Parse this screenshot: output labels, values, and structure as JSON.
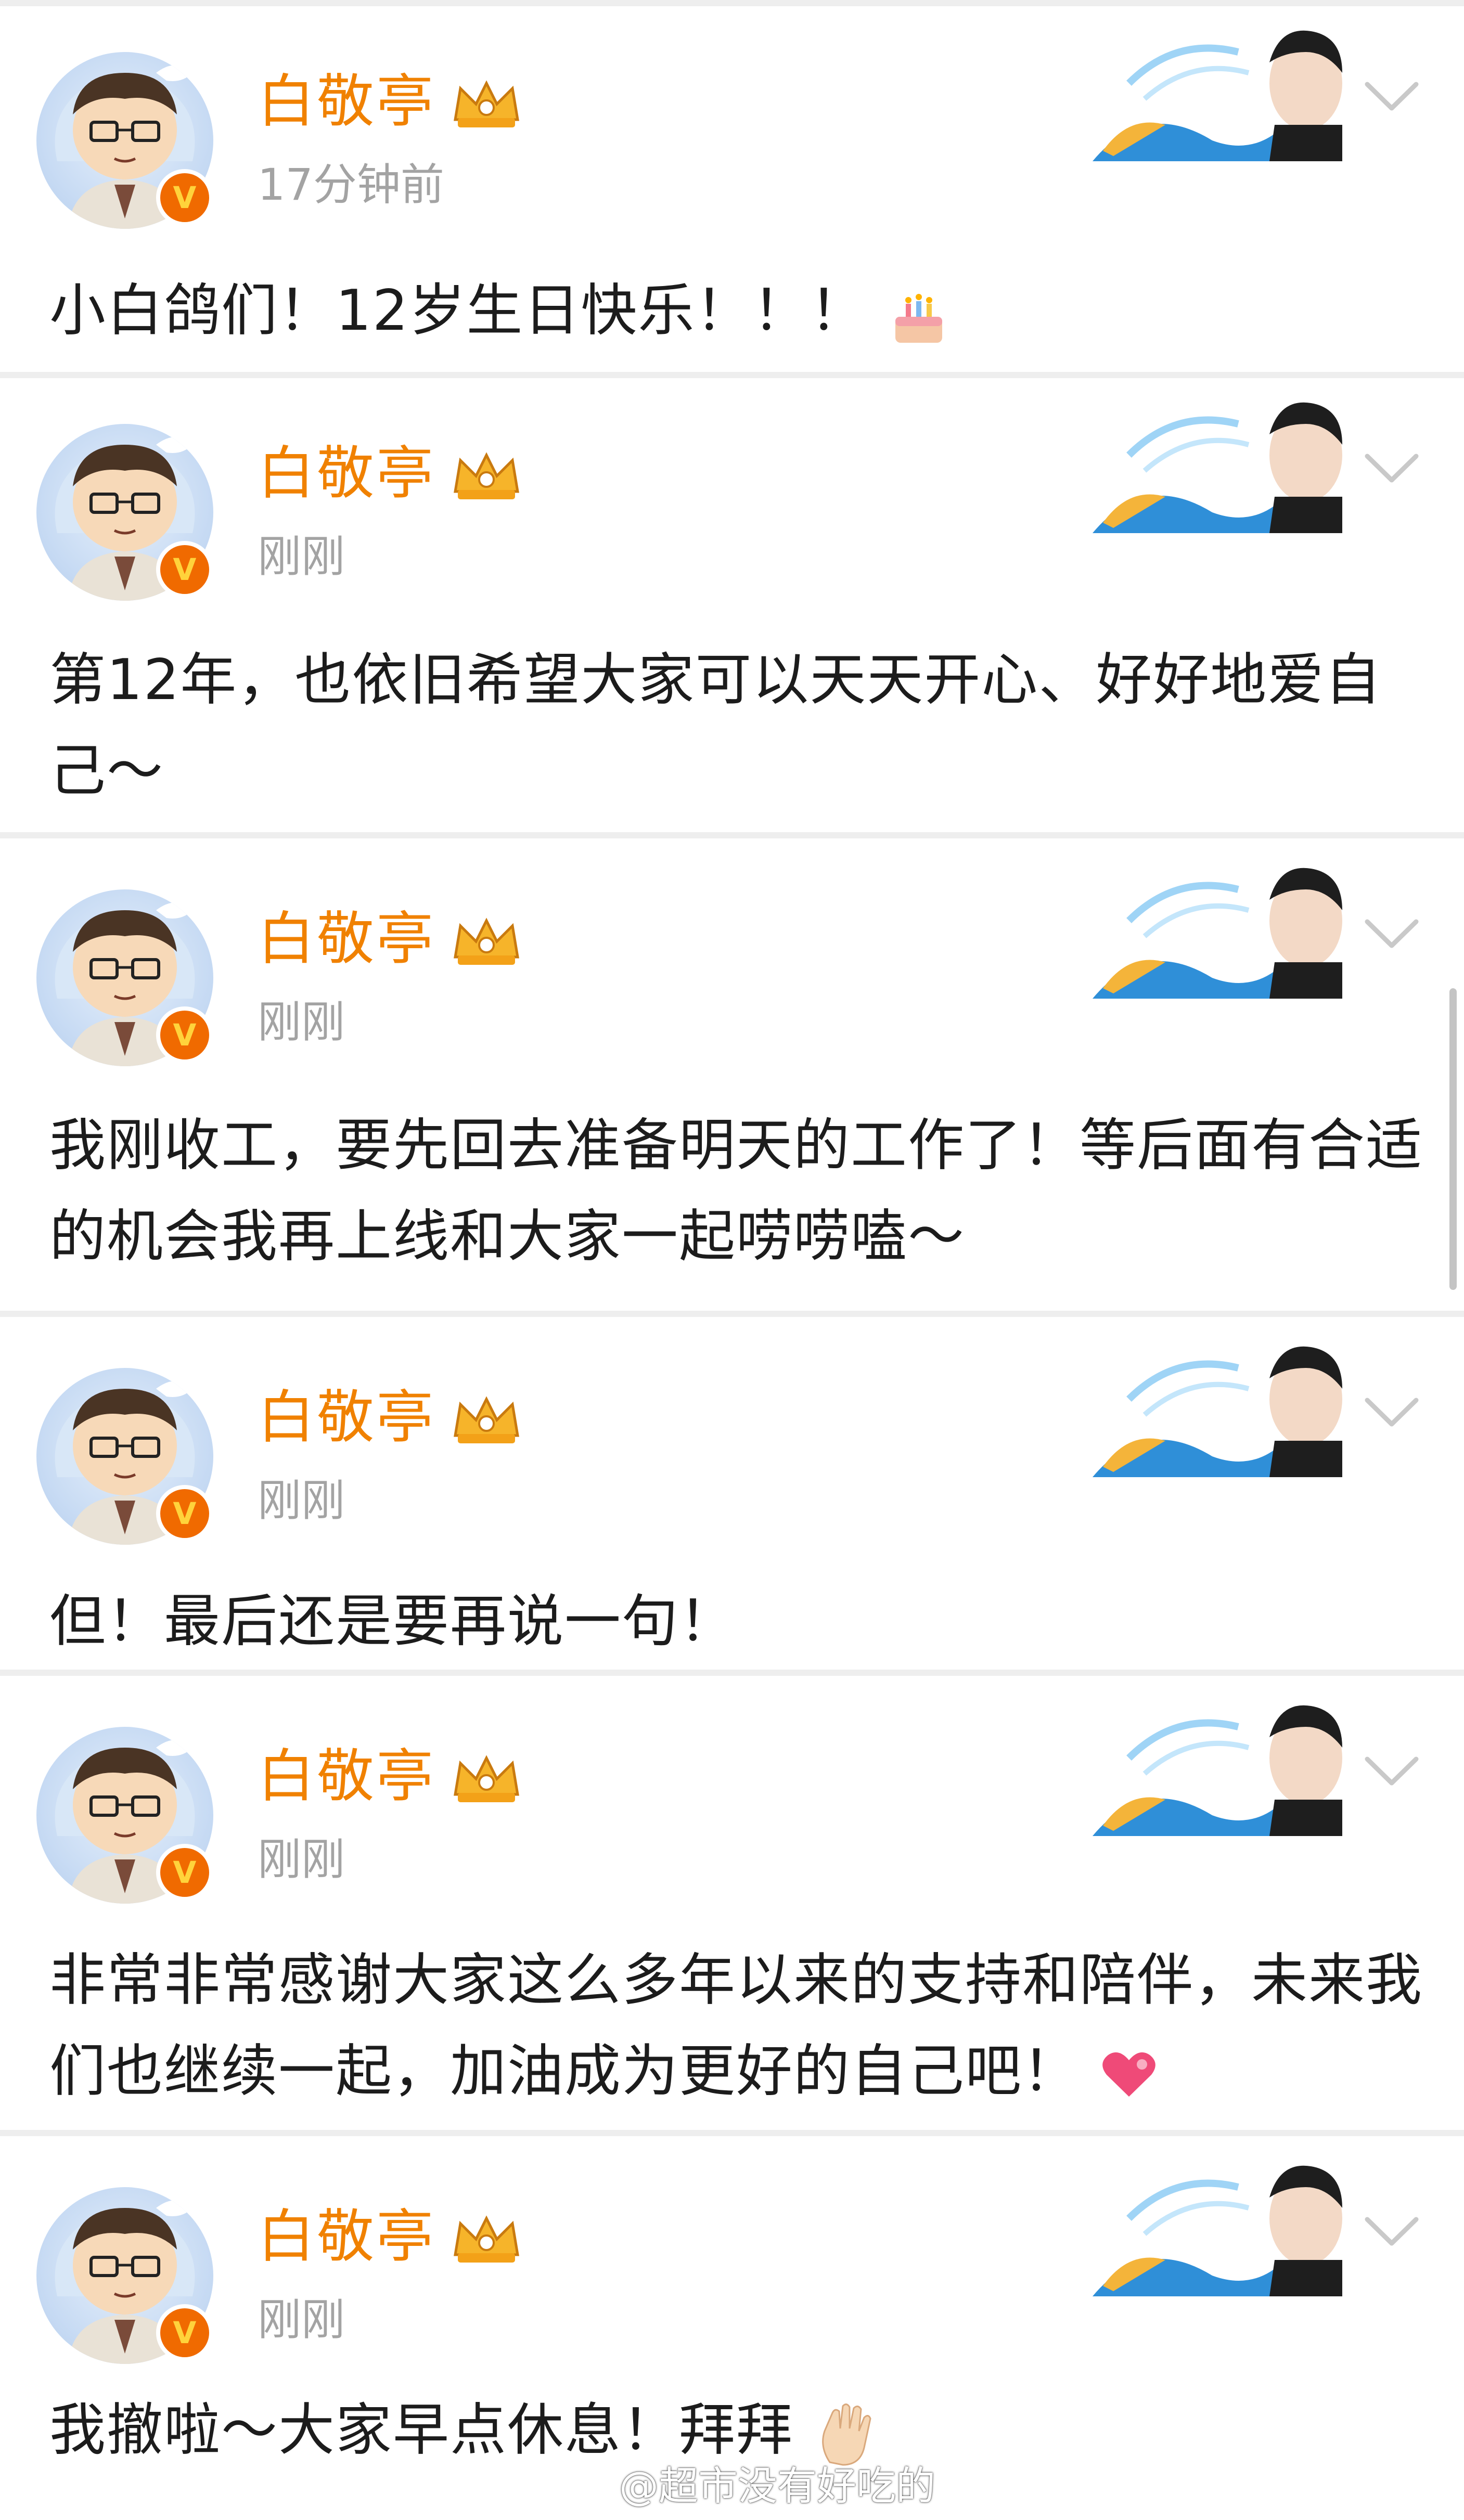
{
  "feed": {
    "username": "白敬亭",
    "icons": {
      "avatar": "cartoon-avatar-image",
      "verified": "verified-v-icon",
      "membership": "crown-membership-icon",
      "decoration": "card-decoration-image",
      "more": "chevron-down-icon"
    },
    "verified_label": "V",
    "posts": [
      {
        "time": "17分钟前",
        "text": "小白鸽们！12岁生日快乐！！！",
        "emoji": "birthday-cake-emoji"
      },
      {
        "time": "刚刚",
        "text": "第12年，也依旧希望大家可以天天开心、好好地爱自己～"
      },
      {
        "time": "刚刚",
        "text": "我刚收工，要先回去准备明天的工作了！等后面有合适的机会我再上线和大家一起唠唠嗑～"
      },
      {
        "time": "刚刚",
        "text": "但！最后还是要再说一句！"
      },
      {
        "time": "刚刚",
        "text": "非常非常感谢大家这么多年以来的支持和陪伴，未来我们也继续一起，加油成为更好的自己吧！",
        "emoji": "heart-emoji"
      },
      {
        "time": "刚刚",
        "text": "我撤啦～大家早点休息！拜拜",
        "emoji": "waving-hand-emoji"
      }
    ]
  },
  "watermark": {
    "text": "@超市没有好吃的",
    "icon": "weibo-logo-icon"
  },
  "colors": {
    "username": "#f08100",
    "timestamp": "#a3a3a3",
    "text": "#1c1c1c",
    "badge": "#f06a00",
    "separator": "#eeeeee"
  }
}
